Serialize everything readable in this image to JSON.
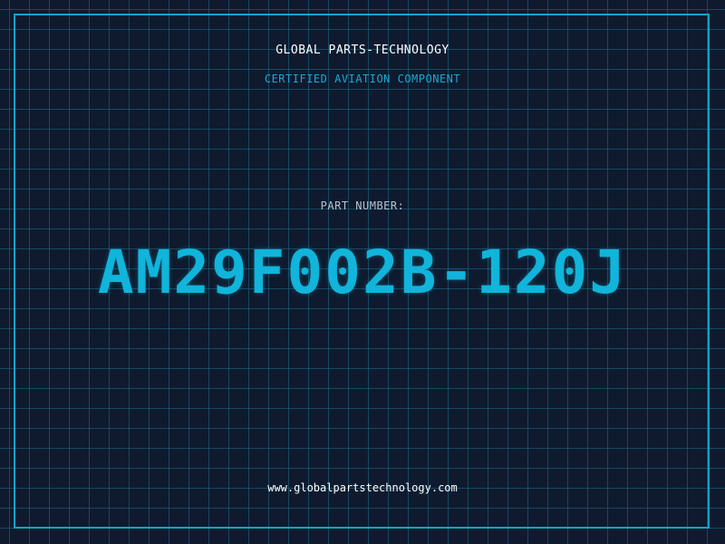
{
  "header": {
    "company_name": "GLOBAL PARTS-TECHNOLOGY",
    "tagline": "CERTIFIED AVIATION COMPONENT"
  },
  "part": {
    "label": "PART NUMBER:",
    "number": "AM29F002B-120J"
  },
  "footer": {
    "website": "www.globalpartstechnology.com"
  },
  "colors": {
    "background": "#0f1a2e",
    "grid": "#1e6e8c",
    "accent": "#14a3c9",
    "part_number": "#11b4da"
  }
}
